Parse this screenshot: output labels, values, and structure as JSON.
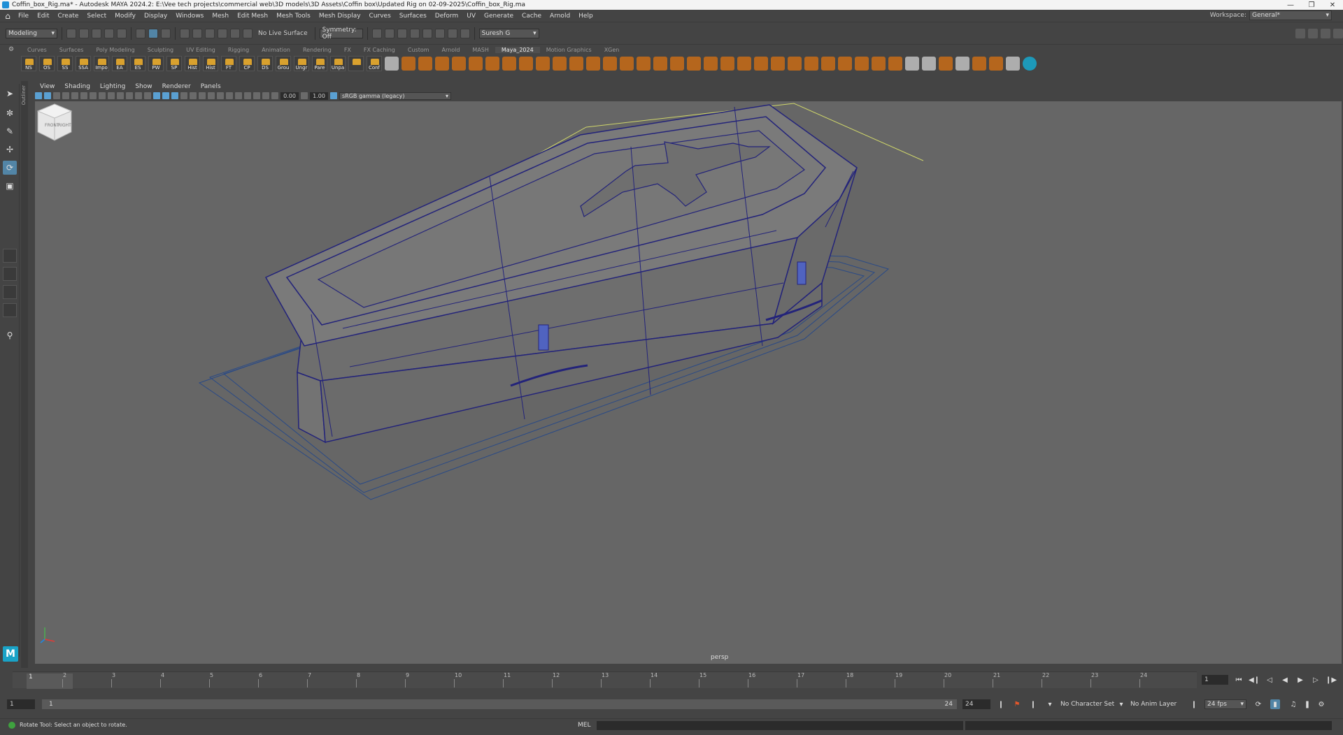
{
  "window": {
    "title": "Coffin_box_Rig.ma* - Autodesk MAYA 2024.2: E:\\Vee tech projects\\commercial web\\3D models\\3D Assets\\Coffin box\\Updated Rig on 02-09-2025\\Coffin_box_Rig.ma"
  },
  "menus": [
    "File",
    "Edit",
    "Create",
    "Select",
    "Modify",
    "Display",
    "Windows",
    "Mesh",
    "Edit Mesh",
    "Mesh Tools",
    "Mesh Display",
    "Curves",
    "Surfaces",
    "Deform",
    "UV",
    "Generate",
    "Cache",
    "Arnold",
    "Help"
  ],
  "workspace": {
    "label": "Workspace:",
    "value": "General*"
  },
  "status_line": {
    "mode": "Modeling",
    "live_surface": "No Live Surface",
    "symmetry": "Symmetry: Off",
    "user": "Suresh G"
  },
  "shelf_tabs": [
    "Curves",
    "Surfaces",
    "Poly Modeling",
    "Sculpting",
    "UV Editing",
    "Rigging",
    "Animation",
    "Rendering",
    "FX",
    "FX Caching",
    "Custom",
    "Arnold",
    "MASH",
    "Maya_2024",
    "Motion Graphics",
    "XGen"
  ],
  "active_shelf_tab": "Maya_2024",
  "shelf_buttons": [
    "NS",
    "OS",
    "SS",
    "SSA",
    "Impo",
    "EA",
    "ES",
    "PW",
    "SP",
    "Hist",
    "Hist",
    "FT",
    "CP",
    "DS",
    "Grou",
    "Ungr",
    "Pare",
    "Unpa",
    "",
    "Conf"
  ],
  "outliner_label": "Outliner",
  "panel_menus": [
    "View",
    "Shading",
    "Lighting",
    "Show",
    "Renderer",
    "Panels"
  ],
  "panel_toolbar": {
    "exposure": "0.00",
    "gamma": "1.00",
    "color_space": "sRGB gamma (legacy)"
  },
  "viewport": {
    "camera_label": "persp"
  },
  "view_cube": {
    "face_left": "FRONT",
    "face_right": "RIGHT"
  },
  "timeline": {
    "ticks": [
      "1",
      "2",
      "3",
      "4",
      "5",
      "6",
      "7",
      "8",
      "9",
      "10",
      "11",
      "12",
      "13",
      "14",
      "15",
      "16",
      "17",
      "18",
      "19",
      "20",
      "21",
      "22",
      "23",
      "24"
    ],
    "current_frame": "1",
    "current_frame_field": "1"
  },
  "range": {
    "start": "1",
    "inner_start": "1",
    "inner_end": "24",
    "end": "24",
    "character_set": "No Character Set",
    "anim_layer": "No Anim Layer",
    "fps": "24 fps"
  },
  "help_line": {
    "text": "Rotate Tool: Select an object to rotate.",
    "mel": "MEL"
  },
  "colors": {
    "viewport_bg": "#666666",
    "wireframe": "#23237a",
    "selection_highlight": "#5285a6",
    "bbox_outline": "#cfd66a",
    "shelf_accent": "#c26a19"
  }
}
